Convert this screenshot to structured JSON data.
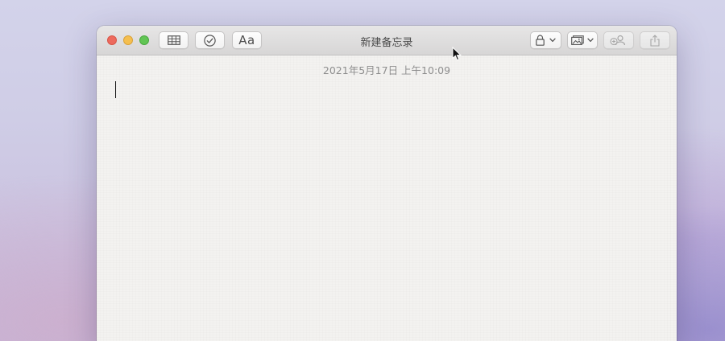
{
  "window": {
    "title": "新建备忘录"
  },
  "toolbar": {
    "format_label": "Aa",
    "buttons": [
      {
        "icon": "table-icon"
      },
      {
        "icon": "checklist-icon"
      },
      {
        "icon": "format-text-icon"
      },
      {
        "icon": "lock-icon",
        "has_menu": true
      },
      {
        "icon": "media-icon",
        "has_menu": true
      },
      {
        "icon": "add-people-icon",
        "enabled": false
      },
      {
        "icon": "share-icon",
        "enabled": false
      }
    ]
  },
  "note": {
    "timestamp": "2021年5月17日 上午10:09",
    "body": ""
  },
  "colors": {
    "close": "#ed6a5e",
    "minimize": "#f5bf4f",
    "zoom": "#61c554",
    "note_background": "#f3f2f0",
    "timestamp_text": "#8e8e8e"
  }
}
